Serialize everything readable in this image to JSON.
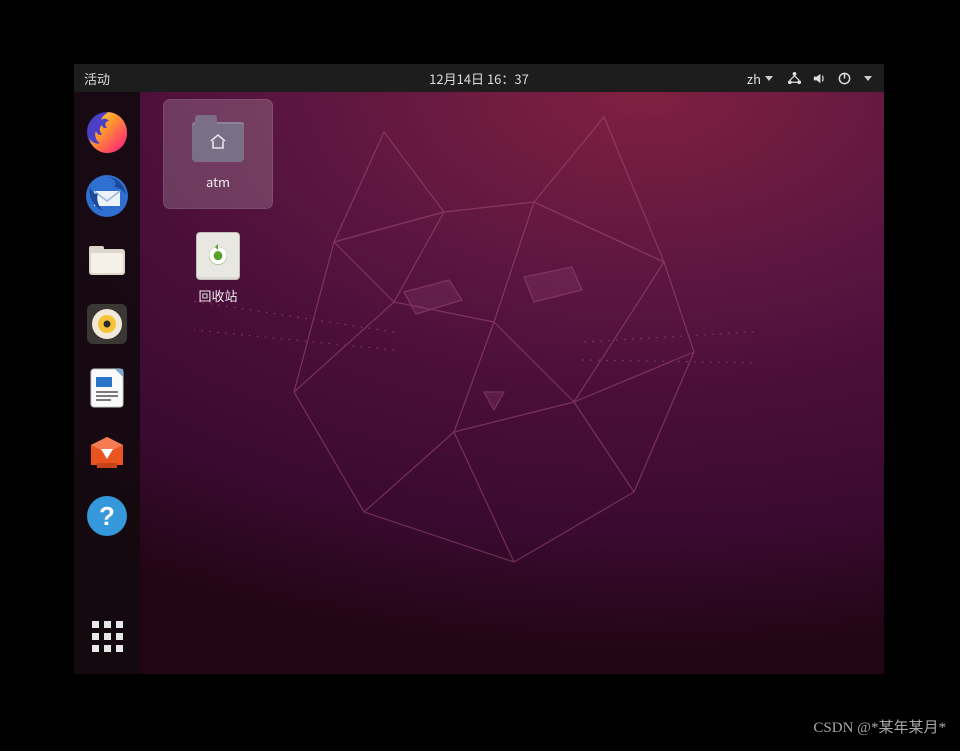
{
  "topbar": {
    "activities": "活动",
    "datetime": "12月14日 16：37",
    "ime_label": "zh"
  },
  "desktop": {
    "icons": [
      {
        "label": "atm"
      },
      {
        "label": "回收站"
      }
    ]
  },
  "dock": {
    "items": [
      {
        "name": "firefox"
      },
      {
        "name": "thunderbird"
      },
      {
        "name": "files"
      },
      {
        "name": "rhythmbox"
      },
      {
        "name": "libreoffice-writer"
      },
      {
        "name": "software"
      },
      {
        "name": "help"
      }
    ]
  },
  "watermark": "CSDN @*某年某月*"
}
